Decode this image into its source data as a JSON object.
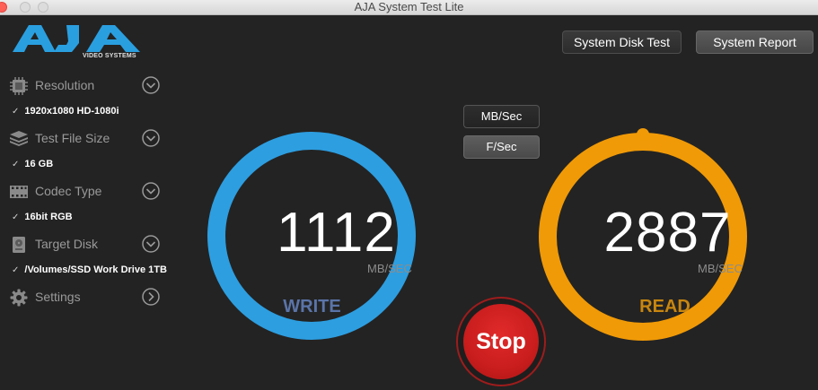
{
  "window": {
    "title": "AJA System Test Lite"
  },
  "logo": {
    "text": "AJA",
    "subtitle": "VIDEO SYSTEMS",
    "color": "#2a9fe0"
  },
  "sidebar": {
    "items": [
      {
        "label": "Resolution",
        "value": "1920x1080 HD-1080i",
        "icon": "resolution-chip-icon"
      },
      {
        "label": "Test File Size",
        "value": "16 GB",
        "icon": "stack-layers-icon"
      },
      {
        "label": "Codec Type",
        "value": "16bit RGB",
        "icon": "film-strip-icon"
      },
      {
        "label": "Target Disk",
        "value": "/Volumes/SSD Work Drive 1TB",
        "icon": "hard-disk-icon"
      },
      {
        "label": "Settings",
        "icon": "gear-icon"
      }
    ],
    "check_mark": "✓"
  },
  "toolbar": {
    "system_disk_test": "System Disk Test",
    "system_report": "System Report"
  },
  "units": {
    "mb_sec": "MB/Sec",
    "f_sec": "F/Sec",
    "selected": "F/Sec"
  },
  "write": {
    "value": "1112",
    "unit": "MB/SEC",
    "label": "WRITE",
    "ring_color": "#2d9ee0",
    "label_color": "#5a74a8"
  },
  "read": {
    "value": "2887",
    "unit": "MB/SEC",
    "label": "READ",
    "ring_color": "#f09a07",
    "label_color": "#c8860f"
  },
  "stop": {
    "label": "Stop"
  }
}
